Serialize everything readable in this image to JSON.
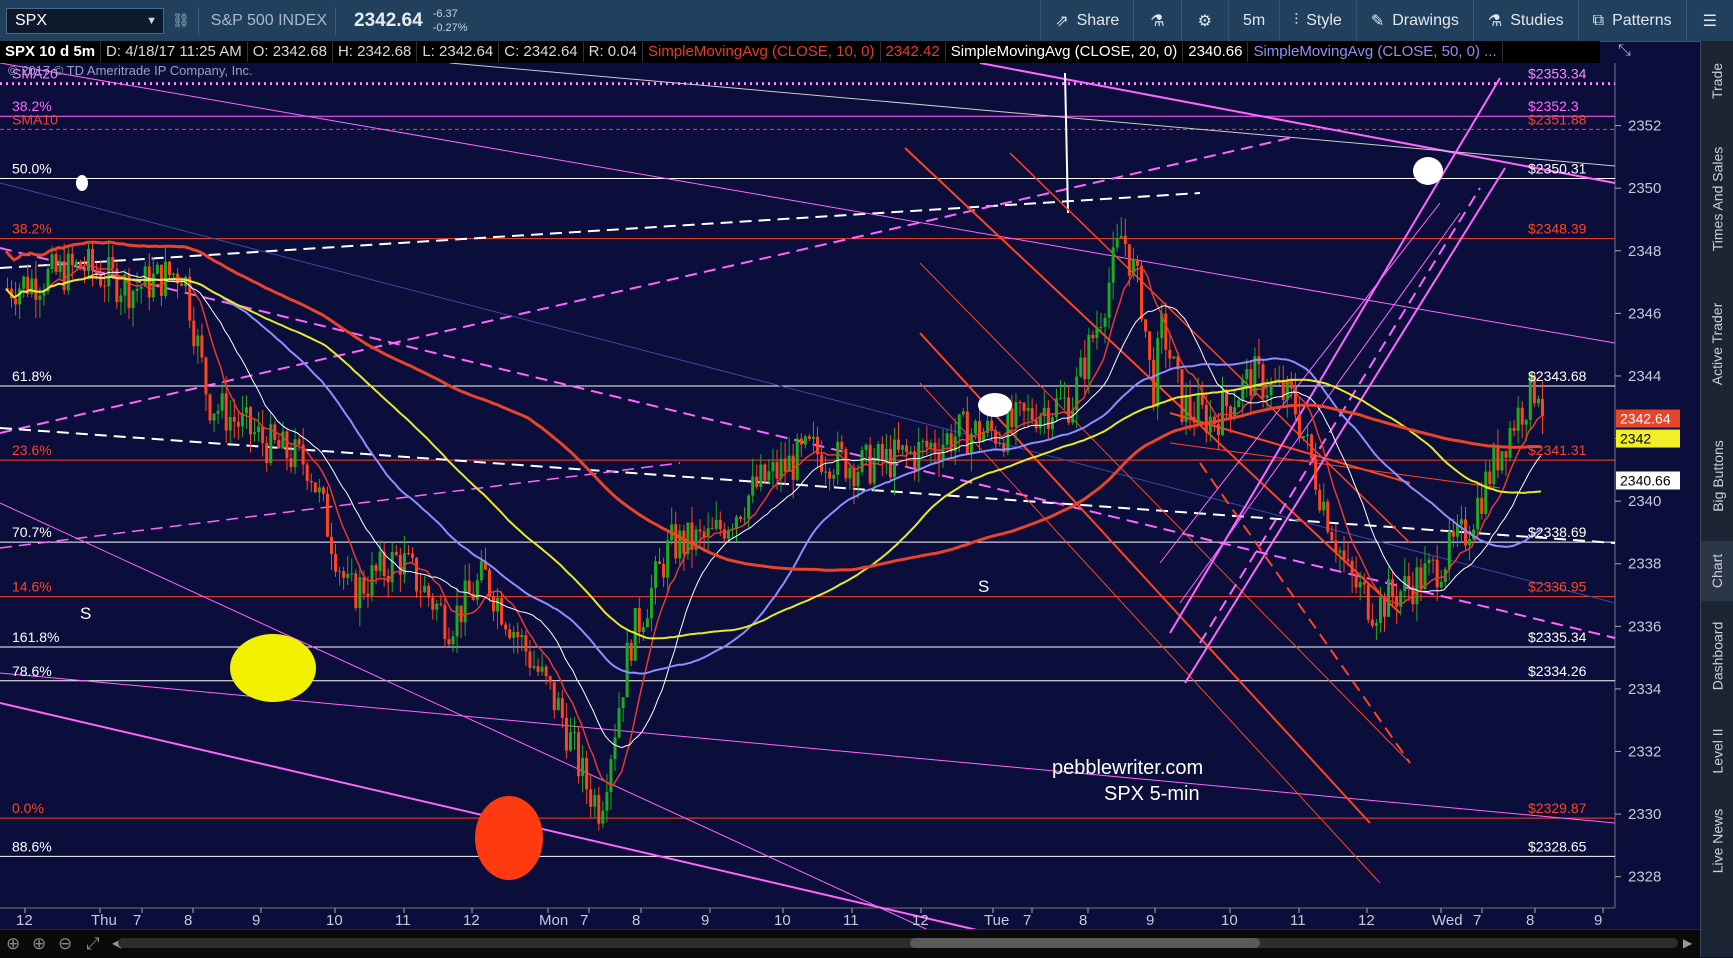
{
  "toolbar": {
    "symbol": "SPX",
    "name": "S&P 500 INDEX",
    "last": "2342.64",
    "change": "-6.37",
    "change_pct": "-0.27%",
    "share": "Share",
    "interval": "5m",
    "style": "Style",
    "drawings": "Drawings",
    "studies": "Studies",
    "patterns": "Patterns",
    "icons": [
      "link-icon",
      "share-icon",
      "flask-icon",
      "gear-icon",
      "style-icon",
      "pencil-icon",
      "studies-icon",
      "patterns-icon",
      "menu-icon"
    ]
  },
  "infobar": {
    "symbol": "SPX 10 d 5m",
    "date": "D: 4/18/17 11:25 AM",
    "open": "O: 2342.68",
    "high": "H: 2342.68",
    "low": "L: 2342.64",
    "close": "C: 2342.64",
    "rng": "R: 0.04",
    "sma10_label": "SimpleMovingAvg (CLOSE, 10, 0)",
    "sma10_value": "2342.42",
    "sma20_label": "SimpleMovingAvg (CLOSE, 20, 0)",
    "sma20_value": "2340.66",
    "sma50_label": "SimpleMovingAvg (CLOSE, 50, 0) ..."
  },
  "right_tabs": [
    "Trade",
    "Times And Sales",
    "Active Trader",
    "Big Buttons",
    "Chart",
    "Dashboard",
    "Level II",
    "Live News"
  ],
  "active_tab": "Chart",
  "colors": {
    "background": "#0b0d3a",
    "sma10": "#e83a2a",
    "sma20": "#ffffff",
    "sma50": "#8d8dff",
    "sma200": "#e8442a",
    "yellow_ma": "#e8e82a",
    "fib_magenta": "#ff66ff",
    "up_candle": "#1faa1f",
    "down_candle": "#ff4422"
  },
  "chart_data": {
    "type": "candlestick",
    "copyright": "© 2017 © TD Ameritrade IP Company, Inc.",
    "watermark": [
      "pebblewriter.com",
      "SPX 5-min"
    ],
    "ylim": [
      2327,
      2354
    ],
    "y_ticks": [
      2328,
      2330,
      2332,
      2334,
      2336,
      2338,
      2340,
      2342,
      2344,
      2346,
      2348,
      2350,
      2352
    ],
    "x_labels": [
      "12",
      "Thu",
      "7",
      "8",
      "9",
      "10",
      "11",
      "12",
      "Mon",
      "7",
      "8",
      "9",
      "10",
      "11",
      "12",
      "Tue",
      "7",
      "8",
      "9",
      "10",
      "11",
      "12",
      "Wed",
      "7",
      "8",
      "9"
    ],
    "levels": [
      {
        "price": 2353.34,
        "left": "SMA20",
        "right": "$2353.34",
        "color": "#ff88ff",
        "dotted": true
      },
      {
        "price": 2352.3,
        "left": "38.2%",
        "right": "$2352.3",
        "color": "#ff66ff"
      },
      {
        "price": 2351.88,
        "left": "SMA10",
        "right": "$2351.88",
        "color": "#ff4422",
        "dashed": true
      },
      {
        "price": 2350.31,
        "left": "50.0%",
        "right": "$2350.31",
        "color": "#ffffff"
      },
      {
        "price": 2348.39,
        "left": "38.2%",
        "right": "$2348.39",
        "color": "#ff4422"
      },
      {
        "price": 2343.68,
        "left": "61.8%",
        "right": "$2343.68",
        "color": "#ffffff"
      },
      {
        "price": 2341.31,
        "left": "23.6%",
        "right": "$2341.31",
        "color": "#ff4422"
      },
      {
        "price": 2338.69,
        "left": "70.7%",
        "right": "$2338.69",
        "color": "#ffffff"
      },
      {
        "price": 2336.95,
        "left": "14.6%",
        "right": "$2336.95",
        "color": "#ff4422"
      },
      {
        "price": 2335.34,
        "left": "161.8%",
        "right": "$2335.34",
        "color": "#ffffff"
      },
      {
        "price": 2334.26,
        "left": "78.6%",
        "right": "$2334.26",
        "color": "#ffffff"
      },
      {
        "price": 2329.87,
        "left": "0.0%",
        "right": "$2329.87",
        "color": "#ff4422"
      },
      {
        "price": 2328.65,
        "left": "88.6%",
        "right": "$2328.65",
        "color": "#ffffff"
      }
    ],
    "price_tags": [
      {
        "price": 2342.64,
        "label": "2342.64",
        "bg": "#e8442a",
        "fg": "#ffffff"
      },
      {
        "price": 2342.0,
        "label": "2342",
        "bg": "#f2ee2a",
        "fg": "#000000"
      },
      {
        "price": 2340.66,
        "label": "2340.66",
        "bg": "#ffffff",
        "fg": "#000000"
      }
    ],
    "markers": [
      "S",
      "S"
    ],
    "anchors": [
      [
        0,
        2346.8
      ],
      [
        15,
        2347.5
      ],
      [
        25,
        2346.8
      ],
      [
        35,
        2347.4
      ],
      [
        40,
        2343.2
      ],
      [
        52,
        2341.8
      ],
      [
        60,
        2341.2
      ],
      [
        68,
        2337
      ],
      [
        78,
        2338.2
      ],
      [
        88,
        2336.1
      ],
      [
        95,
        2337.6
      ],
      [
        102,
        2335.6
      ],
      [
        110,
        2333.3
      ],
      [
        115,
        2331
      ],
      [
        118,
        2330.2
      ],
      [
        124,
        2335.5
      ],
      [
        132,
        2338.6
      ],
      [
        140,
        2338.8
      ],
      [
        150,
        2340.6
      ],
      [
        160,
        2341.6
      ],
      [
        170,
        2341.1
      ],
      [
        180,
        2341.5
      ],
      [
        190,
        2342.2
      ],
      [
        198,
        2342.2
      ],
      [
        205,
        2342.9
      ],
      [
        212,
        2343.2
      ],
      [
        218,
        2346.2
      ],
      [
        222,
        2348.6
      ],
      [
        226,
        2346.3
      ],
      [
        228,
        2343.4
      ],
      [
        230,
        2345.6
      ],
      [
        234,
        2343.0
      ],
      [
        240,
        2342.6
      ],
      [
        248,
        2344
      ],
      [
        256,
        2343.2
      ],
      [
        262,
        2340
      ],
      [
        267,
        2337.6
      ],
      [
        272,
        2336.6
      ],
      [
        278,
        2337.2
      ],
      [
        284,
        2337.8
      ],
      [
        290,
        2338.9
      ],
      [
        296,
        2341.2
      ],
      [
        300,
        2342.6
      ],
      [
        305,
        2343.8
      ],
      [
        306,
        2342.6
      ]
    ]
  }
}
